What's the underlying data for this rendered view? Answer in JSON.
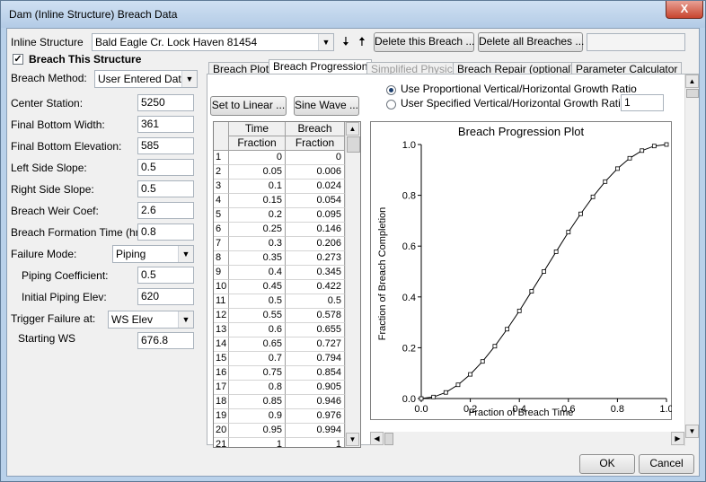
{
  "window": {
    "title": "Dam (Inline Structure) Breach Data",
    "close_glyph": "X"
  },
  "header": {
    "inline_structure_label": "Inline Structure",
    "inline_structure_value": "Bald Eagle Cr.  Lock Haven      81454",
    "down_arrow_glyph": "🠇",
    "up_arrow_glyph": "🠅",
    "delete_breach_label": "Delete this Breach ...",
    "delete_all_label": "Delete all Breaches ...",
    "status_value": ""
  },
  "left": {
    "breach_checkbox_label": "Breach This Structure",
    "breach_checked": "✓",
    "breach_method_label": "Breach Method:",
    "breach_method_value": "User Entered Data",
    "fields": [
      {
        "label": "Center Station:",
        "value": "5250"
      },
      {
        "label": "Final Bottom Width:",
        "value": "361"
      },
      {
        "label": "Final Bottom Elevation:",
        "value": "585"
      },
      {
        "label": "Left Side Slope:",
        "value": "0.5"
      },
      {
        "label": "Right Side Slope:",
        "value": "0.5"
      },
      {
        "label": "Breach Weir Coef:",
        "value": "2.6"
      },
      {
        "label": "Breach Formation Time (hrs):",
        "value": "0.8"
      }
    ],
    "failure_mode_label": "Failure Mode:",
    "failure_mode_value": "Piping",
    "piping_coef_label": "Piping Coefficient:",
    "piping_coef_value": "0.5",
    "initial_piping_label": "Initial Piping Elev:",
    "initial_piping_value": "620",
    "trigger_label": "Trigger Failure at:",
    "trigger_value": "WS Elev",
    "starting_ws_label": "Starting WS",
    "starting_ws_value": "676.8"
  },
  "tabs": [
    {
      "label": "Breach Plot",
      "state": "normal"
    },
    {
      "label": "Breach Progression",
      "state": "active"
    },
    {
      "label": "Simplified Physical",
      "state": "disabled"
    },
    {
      "label": "Breach Repair (optional)",
      "state": "normal"
    },
    {
      "label": "Parameter Calculator",
      "state": "normal"
    }
  ],
  "progression": {
    "set_linear_label": "Set to Linear ...",
    "sine_wave_label": "Sine Wave ...",
    "radio_proportional_label": "Use Proportional Vertical/Horizontal Growth Ratio",
    "radio_user_label": "User Specified Vertical/Horizontal Growth Ratio:",
    "growth_ratio_value": "1",
    "table": {
      "col1_top": "Time",
      "col1_bottom": "Fraction",
      "col2_top": "Breach",
      "col2_bottom": "Fraction",
      "rows": [
        [
          "1",
          "0",
          "0"
        ],
        [
          "2",
          "0.05",
          "0.006"
        ],
        [
          "3",
          "0.1",
          "0.024"
        ],
        [
          "4",
          "0.15",
          "0.054"
        ],
        [
          "5",
          "0.2",
          "0.095"
        ],
        [
          "6",
          "0.25",
          "0.146"
        ],
        [
          "7",
          "0.3",
          "0.206"
        ],
        [
          "8",
          "0.35",
          "0.273"
        ],
        [
          "9",
          "0.4",
          "0.345"
        ],
        [
          "10",
          "0.45",
          "0.422"
        ],
        [
          "11",
          "0.5",
          "0.5"
        ],
        [
          "12",
          "0.55",
          "0.578"
        ],
        [
          "13",
          "0.6",
          "0.655"
        ],
        [
          "14",
          "0.65",
          "0.727"
        ],
        [
          "15",
          "0.7",
          "0.794"
        ],
        [
          "16",
          "0.75",
          "0.854"
        ],
        [
          "17",
          "0.8",
          "0.905"
        ],
        [
          "18",
          "0.85",
          "0.946"
        ],
        [
          "19",
          "0.9",
          "0.976"
        ],
        [
          "20",
          "0.95",
          "0.994"
        ],
        [
          "21",
          "1",
          "1"
        ]
      ]
    }
  },
  "chart_data": {
    "type": "line",
    "title": "Breach Progression Plot",
    "xlabel": "Fraction of Breach Time",
    "ylabel": "Fraction of Breach Completion",
    "xlim": [
      0,
      1
    ],
    "ylim": [
      0,
      1
    ],
    "x_ticks": [
      "0.0",
      "0.2",
      "0.4",
      "0.6",
      "0.8",
      "1.0"
    ],
    "y_ticks": [
      "0.0",
      "0.2",
      "0.4",
      "0.6",
      "0.8",
      "1.0"
    ],
    "x": [
      0,
      0.05,
      0.1,
      0.15,
      0.2,
      0.25,
      0.3,
      0.35,
      0.4,
      0.45,
      0.5,
      0.55,
      0.6,
      0.65,
      0.7,
      0.75,
      0.8,
      0.85,
      0.9,
      0.95,
      1
    ],
    "y": [
      0,
      0.006,
      0.024,
      0.054,
      0.095,
      0.146,
      0.206,
      0.273,
      0.345,
      0.422,
      0.5,
      0.578,
      0.655,
      0.727,
      0.794,
      0.854,
      0.905,
      0.946,
      0.976,
      0.994,
      1
    ],
    "grid": false,
    "marker": "square"
  },
  "footer": {
    "ok_label": "OK",
    "cancel_label": "Cancel"
  },
  "scroll": {
    "up": "▲",
    "down": "▼",
    "left": "◀",
    "right": "▶"
  }
}
